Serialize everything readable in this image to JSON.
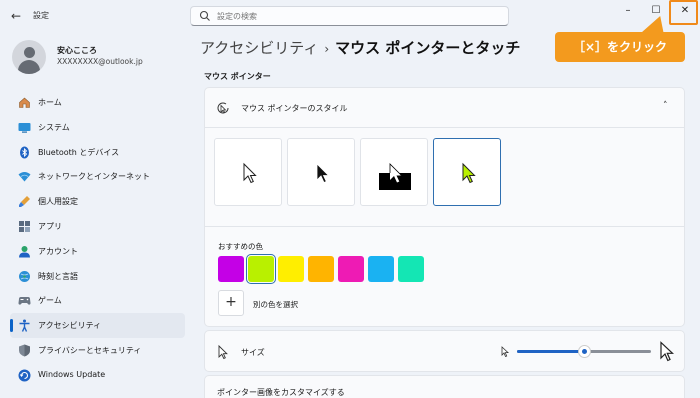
{
  "window": {
    "app_title": "設定",
    "back_label": "←",
    "minimize_label": "–",
    "maximize_label": "☐",
    "close_label": "✕"
  },
  "search": {
    "placeholder": "設定の検索"
  },
  "callout": {
    "text": "［×］をクリック",
    "color": "#f39a1e"
  },
  "profile": {
    "name": "安心こころ",
    "email": "XXXXXXXX@outlook.jp"
  },
  "sidebar": {
    "items": [
      {
        "label": "ホーム",
        "icon": "home-icon",
        "active": false
      },
      {
        "label": "システム",
        "icon": "system-icon",
        "active": false
      },
      {
        "label": "Bluetooth とデバイス",
        "icon": "bluetooth-icon",
        "active": false
      },
      {
        "label": "ネットワークとインターネット",
        "icon": "network-icon",
        "active": false
      },
      {
        "label": "個人用設定",
        "icon": "brush-icon",
        "active": false
      },
      {
        "label": "アプリ",
        "icon": "apps-icon",
        "active": false
      },
      {
        "label": "アカウント",
        "icon": "account-icon",
        "active": false
      },
      {
        "label": "時刻と言語",
        "icon": "time-language-icon",
        "active": false
      },
      {
        "label": "ゲーム",
        "icon": "gaming-icon",
        "active": false
      },
      {
        "label": "アクセシビリティ",
        "icon": "accessibility-icon",
        "active": true
      },
      {
        "label": "プライバシーとセキュリティ",
        "icon": "shield-icon",
        "active": false
      },
      {
        "label": "Windows Update",
        "icon": "update-icon",
        "active": false
      }
    ]
  },
  "breadcrumb": {
    "parent": "アクセシビリティ",
    "separator": "›",
    "current": "マウス ポインターとタッチ"
  },
  "main": {
    "section_title": "マウス ポインター",
    "style_card": {
      "title": "マウス ポインターのスタイル",
      "expanded_chevron": "˄",
      "styles": [
        {
          "name": "white",
          "selected": false
        },
        {
          "name": "black",
          "selected": false
        },
        {
          "name": "inverted",
          "selected": false
        },
        {
          "name": "custom",
          "selected": true
        }
      ],
      "recommended_colors_label": "おすすめの色",
      "recommended_colors": [
        {
          "color": "#c400e6",
          "selected": false
        },
        {
          "color": "#b9f000",
          "selected": true
        },
        {
          "color": "#ffee00",
          "selected": false
        },
        {
          "color": "#ffb400",
          "selected": false
        },
        {
          "color": "#ee1bb4",
          "selected": false
        },
        {
          "color": "#1ab2f2",
          "selected": false
        },
        {
          "color": "#14e6b4",
          "selected": false
        }
      ],
      "add_color_symbol": "+",
      "add_color_label": "別の色を選択"
    },
    "size_card": {
      "label": "サイズ",
      "slider_fraction": 0.5
    },
    "customize_card": {
      "label": "ポインター画像をカスタマイズする"
    }
  },
  "colors": {
    "accent": "#1f63c4",
    "selected_cursor": "#b9f000"
  }
}
